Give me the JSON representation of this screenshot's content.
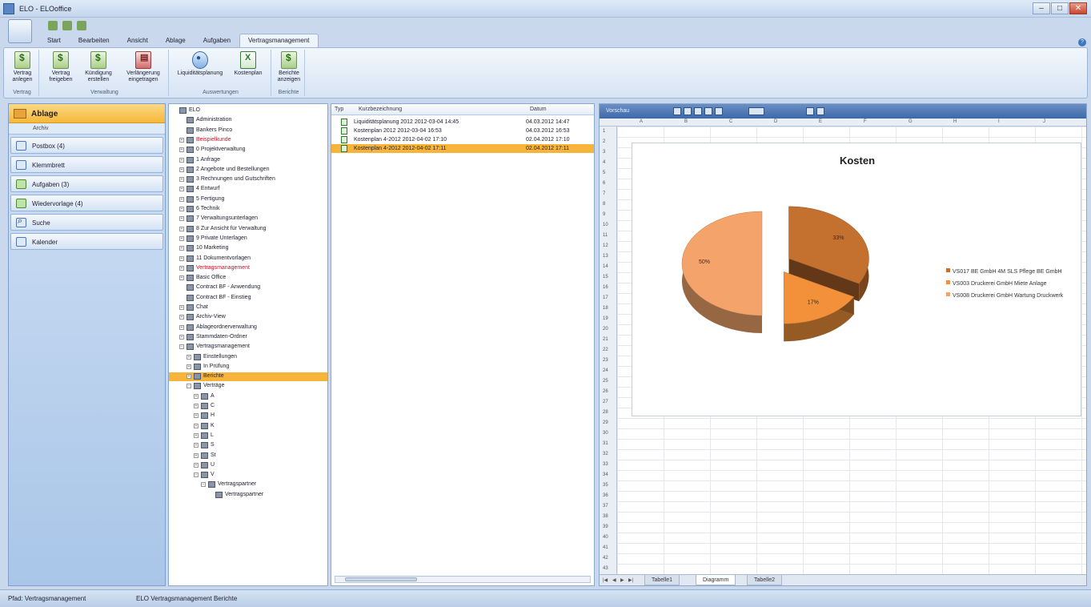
{
  "window": {
    "title": "ELO - ELOoffice"
  },
  "ribbon": {
    "tabs": [
      {
        "label": "Start"
      },
      {
        "label": "Bearbeiten"
      },
      {
        "label": "Ansicht"
      },
      {
        "label": "Ablage"
      },
      {
        "label": "Aufgaben"
      },
      {
        "label": "Vertragsmanagement"
      }
    ],
    "groups": [
      {
        "label": "Vertrag",
        "buttons": [
          "Vertrag anlegen"
        ]
      },
      {
        "label": "Verwaltung",
        "buttons": [
          "Vertrag freigeben",
          "Kündigung erstellen",
          "Verlängerung eingetragen"
        ]
      },
      {
        "label": "Auswertungen",
        "buttons": [
          "Liquiditätsplanung",
          "Kostenplan"
        ]
      },
      {
        "label": "Berichte",
        "buttons": [
          "Berichte anzeigen"
        ]
      }
    ]
  },
  "nav": {
    "header": "Ablage",
    "sub": "Archiv",
    "items": [
      {
        "label": "Postbox (4)"
      },
      {
        "label": "Klemmbrett"
      },
      {
        "label": "Aufgaben (3)"
      },
      {
        "label": "Wiedervorlage (4)"
      },
      {
        "label": "Suche"
      },
      {
        "label": "Kalender"
      }
    ]
  },
  "tree": [
    {
      "label": "ELO",
      "level": 0,
      "exp": ""
    },
    {
      "label": "Administration",
      "level": 1,
      "exp": ""
    },
    {
      "label": "Bankers Pinco",
      "level": 1,
      "exp": ""
    },
    {
      "label": "Beispielkunde",
      "level": 1,
      "exp": "+",
      "red": true
    },
    {
      "label": "0 Projektverwaltung",
      "level": 1,
      "exp": "+"
    },
    {
      "label": "1 Anfrage",
      "level": 1,
      "exp": "+"
    },
    {
      "label": "2 Angebote und Bestellungen",
      "level": 1,
      "exp": "+"
    },
    {
      "label": "3 Rechnungen und Gutschriften",
      "level": 1,
      "exp": "+"
    },
    {
      "label": "4 Entwurf",
      "level": 1,
      "exp": "+"
    },
    {
      "label": "5 Fertigung",
      "level": 1,
      "exp": "+"
    },
    {
      "label": "6 Technik",
      "level": 1,
      "exp": "+"
    },
    {
      "label": "7 Verwaltungsunterlagen",
      "level": 1,
      "exp": "+"
    },
    {
      "label": "8 Zur Ansicht für Verwaltung",
      "level": 1,
      "exp": "+"
    },
    {
      "label": "9 Private Unterlagen",
      "level": 1,
      "exp": "+"
    },
    {
      "label": "10 Marketing",
      "level": 1,
      "exp": "+"
    },
    {
      "label": "11 Dokumentvorlagen",
      "level": 1,
      "exp": "+"
    },
    {
      "label": "Vertragsmanagement",
      "level": 1,
      "exp": "+",
      "red": true
    },
    {
      "label": "Basic Office",
      "level": 1,
      "exp": "+"
    },
    {
      "label": "Contract BF - Anwendung",
      "level": 1,
      "exp": ""
    },
    {
      "label": "Contract BF - Einstieg",
      "level": 1,
      "exp": ""
    },
    {
      "label": "Chat",
      "level": 1,
      "exp": "+"
    },
    {
      "label": "Archiv-View",
      "level": 1,
      "exp": "+"
    },
    {
      "label": "Ablageordnerverwaltung",
      "level": 1,
      "exp": "+"
    },
    {
      "label": "Stammdaten-Ordner",
      "level": 1,
      "exp": "+"
    },
    {
      "label": "Vertragsmanagement",
      "level": 1,
      "exp": "−"
    },
    {
      "label": "Einstellungen",
      "level": 2,
      "exp": "+"
    },
    {
      "label": "In Prüfung",
      "level": 2,
      "exp": "+"
    },
    {
      "label": "Berichte",
      "level": 2,
      "exp": "+",
      "selected": true
    },
    {
      "label": "Verträge",
      "level": 2,
      "exp": "−"
    },
    {
      "label": "A",
      "level": 3,
      "exp": "+"
    },
    {
      "label": "C",
      "level": 3,
      "exp": "+"
    },
    {
      "label": "H",
      "level": 3,
      "exp": "+"
    },
    {
      "label": "K",
      "level": 3,
      "exp": "+"
    },
    {
      "label": "L",
      "level": 3,
      "exp": "+"
    },
    {
      "label": "S",
      "level": 3,
      "exp": "+"
    },
    {
      "label": "St",
      "level": 3,
      "exp": "+"
    },
    {
      "label": "U",
      "level": 3,
      "exp": "+"
    },
    {
      "label": "V",
      "level": 3,
      "exp": "−"
    },
    {
      "label": "Vertragspartner",
      "level": 4,
      "exp": "−"
    },
    {
      "label": "Vertragspartner",
      "level": 5,
      "exp": ""
    }
  ],
  "list": {
    "headers": {
      "type": "Typ",
      "name": "Kurzbezeichnung",
      "date": "Datum"
    },
    "rows": [
      {
        "name": "Liquiditätsplanung 2012 2012-03-04 14:45",
        "date": "04.03.2012 14:47"
      },
      {
        "name": "Kostenplan 2012 2012-03-04 16:53",
        "date": "04.03.2012 16:53"
      },
      {
        "name": "Kostenplan 4-2012 2012-04-02 17:10",
        "date": "02.04.2012 17:10"
      },
      {
        "name": "Kostenplan 4-2012 2012-04-02 17:11",
        "date": "02.04.2012 17:11",
        "selected": true
      }
    ]
  },
  "preview": {
    "toolbar_label": "Vorschau",
    "columns": [
      "A",
      "B",
      "C",
      "D",
      "E",
      "F",
      "G",
      "H",
      "I",
      "J",
      "K"
    ],
    "sheets": [
      "Tabelle1",
      "Diagramm",
      "Tabelle2"
    ],
    "active_sheet": 1
  },
  "chart_data": {
    "type": "pie",
    "title": "Kosten",
    "style": "3d-exploded",
    "slices": [
      {
        "label": "VS017 BE GmbH 4M SLS Pflege BE GmbH",
        "value": 33,
        "color": "#c4702f"
      },
      {
        "label": "VS003 Druckerei GmbH Miete Anlage",
        "value": 17,
        "color": "#f2913a"
      },
      {
        "label": "VS008 Druckerei GmbH Wartung Druckwerk",
        "value": 50,
        "color": "#f4a46a"
      }
    ],
    "data_labels": [
      "33%",
      "17%",
      "50%"
    ],
    "legend_position": "right"
  },
  "status": {
    "left": "Pfad: Vertragsmanagement",
    "right": "ELO Vertragsmanagement Berichte"
  }
}
